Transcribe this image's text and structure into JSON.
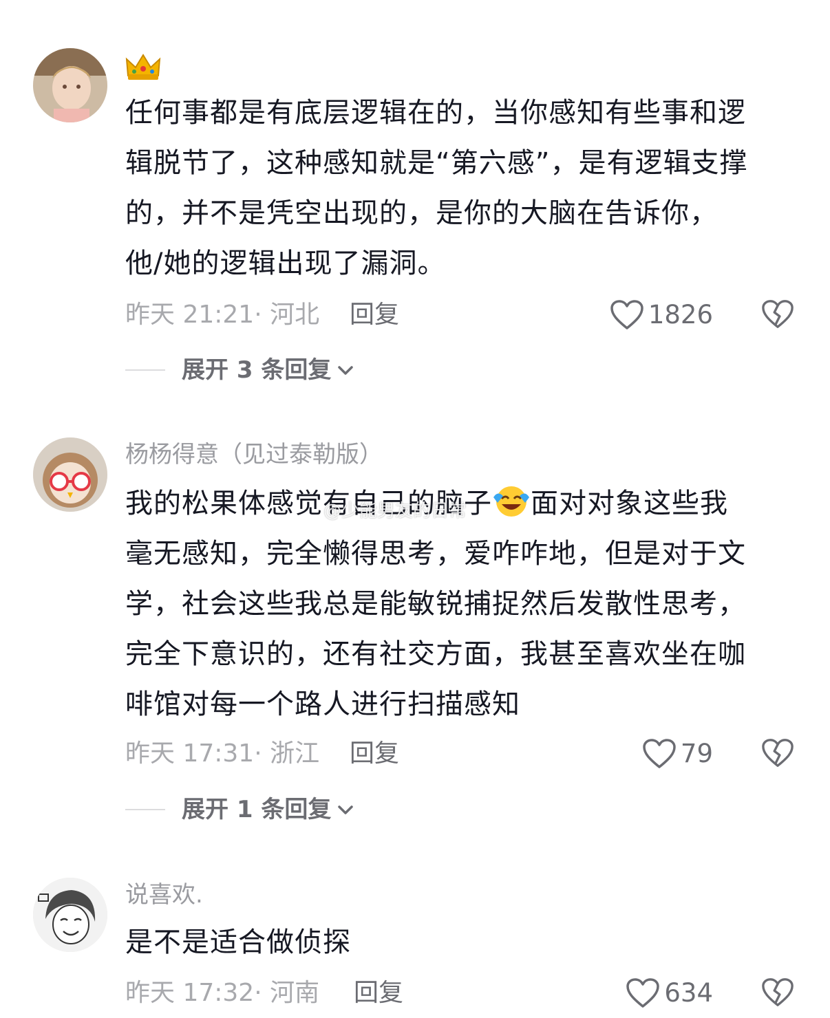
{
  "comments": [
    {
      "username": "",
      "text_lines": [
        "任何事都是有底层逻辑在的，当你感知有些事和逻",
        "辑脱节了，这种感知就是“第六感”，是有逻辑支撑",
        "的，并不是凭空出现的，是你的大脑在告诉你，",
        "他/她的逻辑出现了漏洞。"
      ],
      "meta": "昨天 21:21· 河北",
      "reply_label": "回复",
      "likes": "1826",
      "expand_label": "展开 3 条回复"
    },
    {
      "username": "杨杨得意（见过泰勒版）",
      "text_line1_before_emoji": "我的松果体感觉有自己的脑子",
      "text_line1_after_emoji": "面对对象这些我",
      "text_lines": [
        "毫无感知，完全懒得思考，爱咋咋地，但是对于文",
        "学，社会这些我总是能敏锐捕捉然后发散性思考，",
        "完全下意识的，还有社交方面，我甚至喜欢坐在咖",
        "啡馆对每一个路人进行扫描感知"
      ],
      "meta": "昨天 17:31· 浙江",
      "reply_label": "回复",
      "likes": "79",
      "expand_label": "展开 1 条回复"
    },
    {
      "username": "说喜欢.",
      "text": "是不是适合做侦探",
      "meta": "昨天 17:32· 河南",
      "reply_label": "回复",
      "likes": "634"
    }
  ],
  "watermark": "@少能男友的日常",
  "colors": {
    "text": "#161823",
    "meta": "#a8a9ad",
    "action": "#6b6c72"
  }
}
